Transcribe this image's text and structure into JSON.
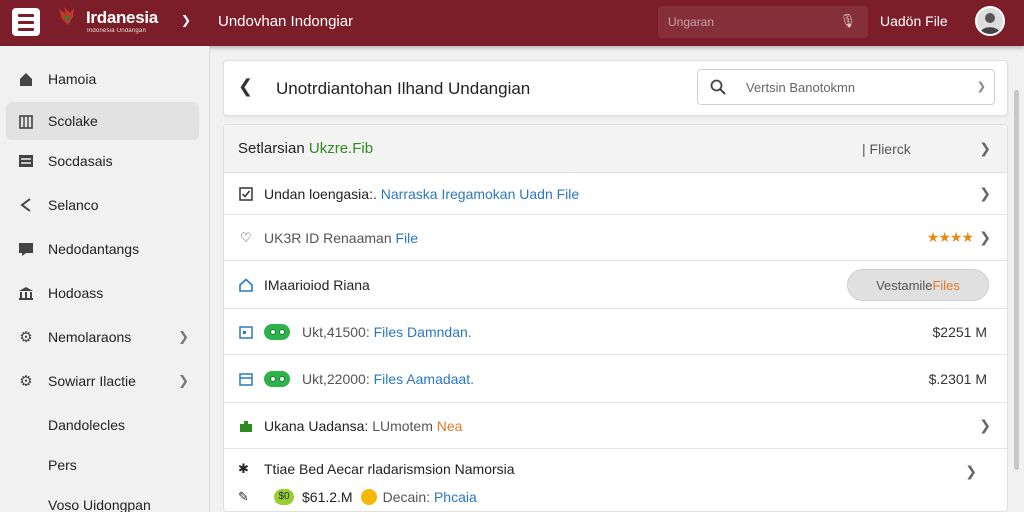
{
  "topbar": {
    "brand": "Irdanesia",
    "brand_sub": "Indonesia Undangan",
    "title": "Undovhan Indongiar",
    "search_placeholder": "Ungaran",
    "upload_label": "Uadön File",
    "accent_color": "#7b1e2a"
  },
  "sidebar": {
    "items": [
      {
        "label": "Hamoia",
        "icon": "home-icon"
      },
      {
        "label": "Scolake",
        "icon": "building-icon"
      },
      {
        "label": "Socdasais",
        "icon": "list-icon"
      },
      {
        "label": "Selanco",
        "icon": "share-icon"
      },
      {
        "label": "Nedodantangs",
        "icon": "inbox-icon"
      },
      {
        "label": "Hodoass",
        "icon": "bank-icon"
      },
      {
        "label": "Nemolaraons",
        "icon": "gear-icon"
      },
      {
        "label": "Sowiarr Ilactie",
        "icon": "gear-icon"
      },
      {
        "label": "Dandolecles"
      },
      {
        "label": "Pers"
      },
      {
        "label": "Voso Uidongpan"
      }
    ]
  },
  "main": {
    "title": "Unotrdiantohan Ilhand Undangian",
    "search_placeholder": "Vertsin Banotokmn",
    "section": {
      "prefix": "Setlarsian",
      "highlight": "Ukzre.Fib",
      "filter": "| Flierck"
    },
    "rows": [
      {
        "label": "Undan loengasia:.",
        "value": "Narraska Iregamokan Uadn File"
      },
      {
        "label": "UK3R ID Renaaman",
        "value": "File",
        "rating": "★★★★"
      },
      {
        "label": "IMaarioiod Riana",
        "button": "Vestamile",
        "button_accent": "Files"
      },
      {
        "label": "Ukt,41500:",
        "value": "Files Damndan.",
        "amount": "$2251 M"
      },
      {
        "label": "Ukt,22000:",
        "value": "Files Aamadaat.",
        "amount": "$.2301 M"
      },
      {
        "label": "Ukana Uadansa:",
        "value": "LUmotem",
        "value_accent": "Nea"
      }
    ],
    "footer": {
      "line1": "Ttiae Bed Aecar rladarismsion Namorsia",
      "amount": "$61.2.M",
      "chip": "$0",
      "label": "Decain:",
      "value": "Phcaia"
    }
  }
}
